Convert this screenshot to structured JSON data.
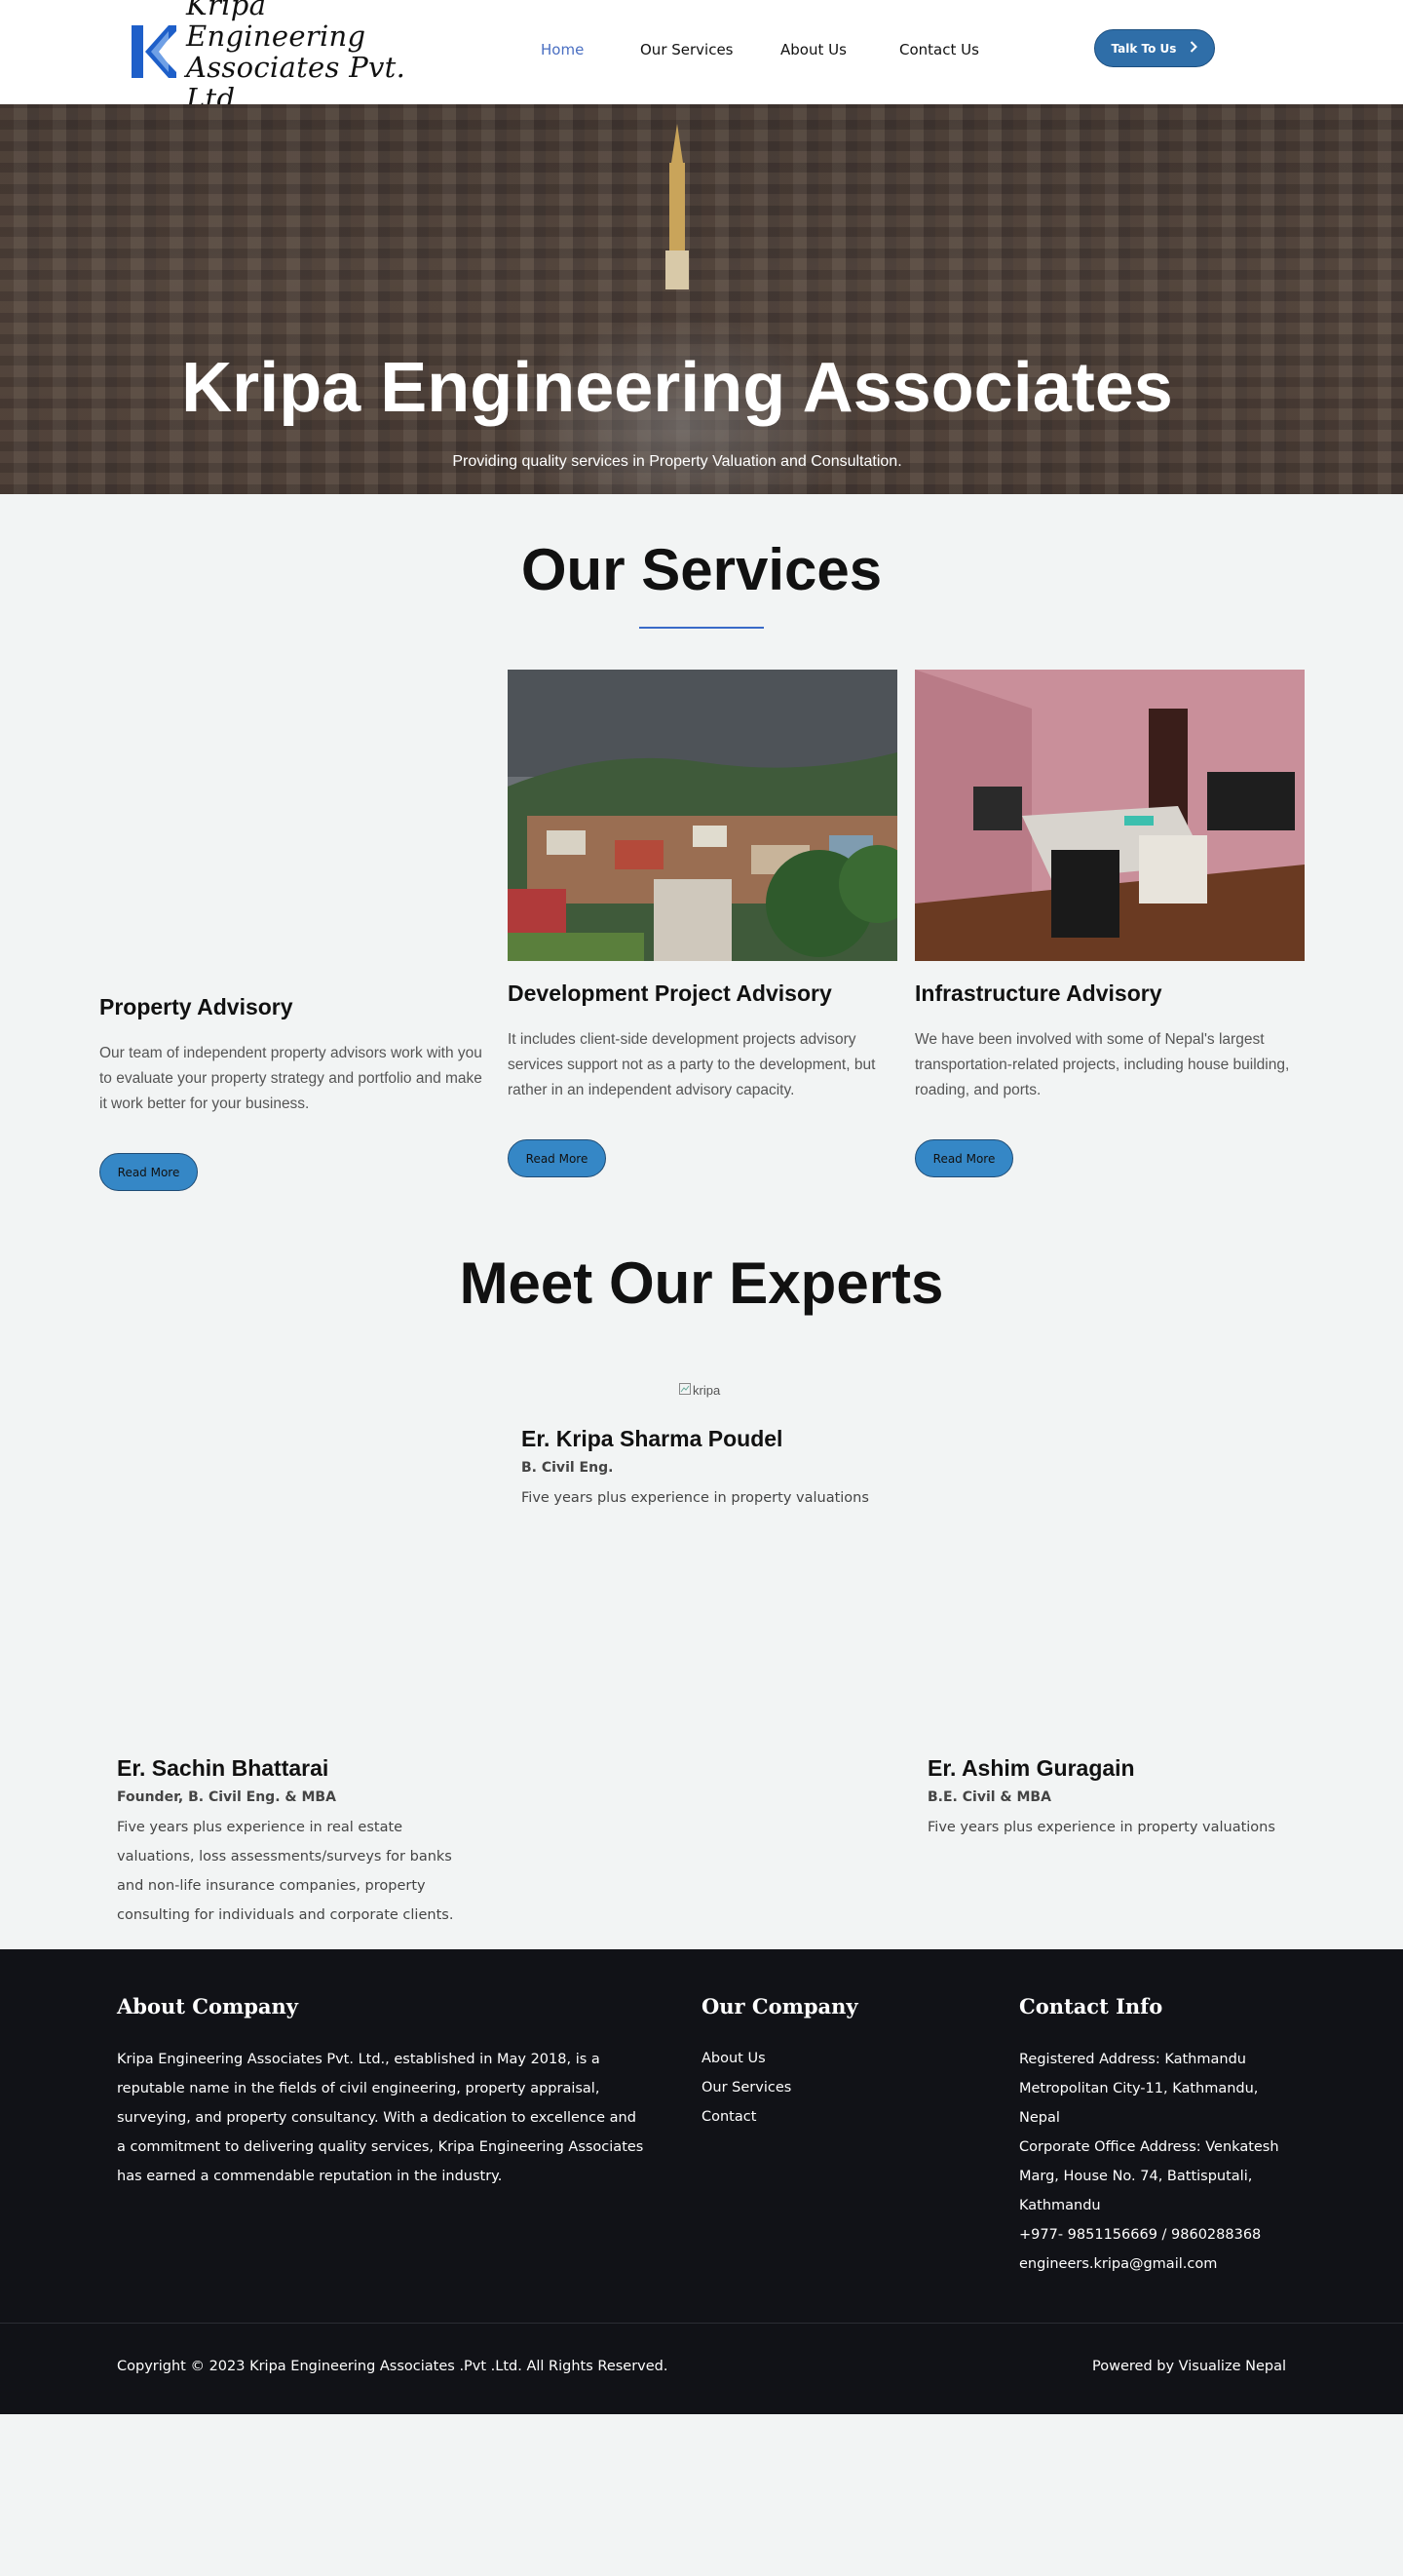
{
  "header": {
    "logo_line1": "Kripa Engineering",
    "logo_line2": "Associates Pvt. Ltd.",
    "nav": [
      {
        "label": "Home",
        "active": true
      },
      {
        "label": "Our Services",
        "active": false
      },
      {
        "label": "About Us",
        "active": false
      },
      {
        "label": "Contact Us",
        "active": false
      }
    ],
    "cta_label": "Talk To Us",
    "cta_icon": "chevron-right-icon"
  },
  "hero": {
    "title": "Kripa Engineering Associates",
    "subtitle": "Providing quality services in Property Valuation and Consultation."
  },
  "services": {
    "title": "Our Services",
    "cards": [
      {
        "title": "Property Advisory",
        "text": "Our team of independent property advisors work with you to evaluate your property strategy and portfolio and make it work better for your business.",
        "button": "Read More"
      },
      {
        "title": "Development Project Advisory",
        "text": "It includes client-side development projects advisory services support not as a party to the development, but rather in an independent advisory capacity.",
        "button": "Read More"
      },
      {
        "title": "Infrastructure Advisory",
        "text": "We have been involved with some of Nepal's largest transportation-related projects, including house building, roading, and ports.",
        "button": "Read More"
      }
    ]
  },
  "experts": {
    "title": "Meet Our Experts",
    "image_alt": "kripa",
    "people": [
      {
        "name": "Er. Kripa Sharma Poudel",
        "degree": "B. Civil Eng.",
        "desc": "Five years plus experience in property valuations"
      },
      {
        "name": "Er. Sachin Bhattarai",
        "degree": "Founder, B. Civil Eng. & MBA",
        "desc": "Five years plus experience in real estate valuations, loss assessments/surveys for banks and non-life insurance companies, property consulting for individuals and corporate clients."
      },
      {
        "name": "Er. Ashim Guragain",
        "degree": "B.E. Civil & MBA",
        "desc": "Five years plus experience in property valuations"
      }
    ]
  },
  "footer": {
    "about_title": "About Company",
    "about_text": "Kripa Engineering Associates Pvt. Ltd., established in May 2018, is a reputable name in the fields of civil engineering, property appraisal, surveying, and property consultancy. With a dedication to excellence and a commitment to delivering quality services, Kripa Engineering Associates has earned a commendable reputation in the industry.",
    "company_title": "Our Company",
    "company_links": [
      "About Us",
      "Our Services",
      "Contact"
    ],
    "contact_title": "Contact Info",
    "contact_registered": "Registered Address: Kathmandu Metropolitan City-11, Kathmandu, Nepal",
    "contact_office": "Corporate Office Address: Venkatesh Marg, House No. 74, Battisputali, Kathmandu",
    "contact_phone": "+977- 9851156669 / 9860288368",
    "contact_email": "engineers.kripa@gmail.com",
    "copyright": "Copyright © 2023 Kripa Engineering Associates .Pvt .Ltd. All Rights Reserved.",
    "powered": "Powered by Visualize Nepal"
  },
  "colors": {
    "accent": "#3587c6",
    "nav_active": "#4a6fc2",
    "footer_bg": "#111217",
    "page_bg": "#f2f4f4"
  }
}
